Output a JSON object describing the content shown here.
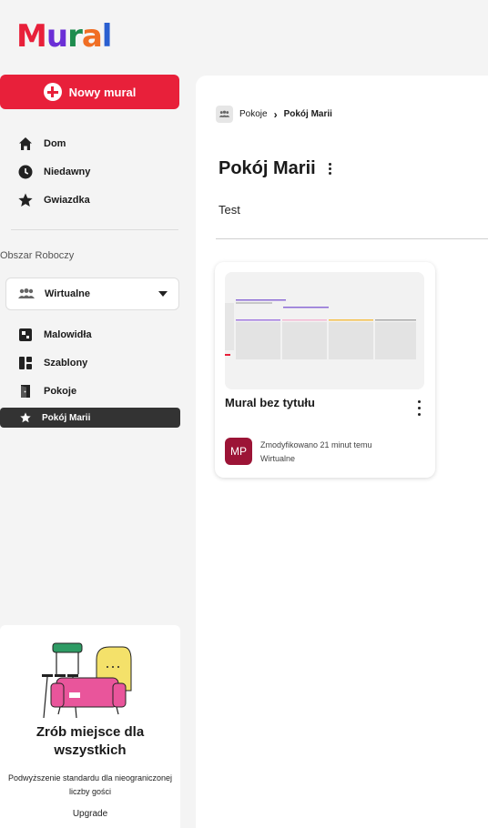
{
  "app": {
    "logo": [
      "M",
      "u",
      "r",
      "a",
      "l"
    ],
    "logo_colors": [
      "#e8203a",
      "#6b2fd6",
      "#1e8c4e",
      "#f06e24",
      "#2a5fd0"
    ]
  },
  "sidebar": {
    "new_mural_label": "Nowy mural",
    "nav": [
      {
        "label": "Dom",
        "icon": "home-icon"
      },
      {
        "label": "Niedawny",
        "icon": "clock-icon"
      },
      {
        "label": "Gwiazdka",
        "icon": "star-icon"
      }
    ],
    "workspace_section_label": "Obszar Roboczy",
    "workspace_name": "Wirtualne",
    "workspace_nav": [
      {
        "label": "Malowidła",
        "icon": "mural-icon"
      },
      {
        "label": "Szablony",
        "icon": "templates-icon"
      },
      {
        "label": "Pokoje",
        "icon": "door-icon"
      },
      {
        "label": "Pokój Marii",
        "icon": "star-icon",
        "active": true
      }
    ],
    "promo": {
      "title": "Zrób miejsce dla wszystkich",
      "text": "Podwyższenie standardu dla nieograniczonej liczby gości",
      "link": "Upgrade"
    }
  },
  "main": {
    "breadcrumb": {
      "parent": "Pokoje",
      "current": "Pokój Marii"
    },
    "title": "Pokój Marii",
    "description": "Test",
    "cards": [
      {
        "title": "Mural bez tytułu",
        "avatar": "MP",
        "modified": "Zmodyfikowano 21 minut temu",
        "workspace": "Wirtualne"
      }
    ]
  },
  "colors": {
    "accent": "#e8203a",
    "avatar": "#9c1436",
    "active_item": "#333333"
  }
}
